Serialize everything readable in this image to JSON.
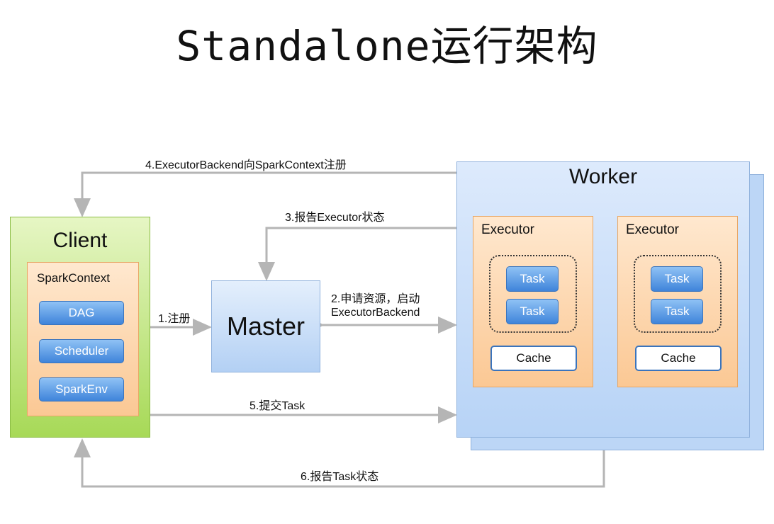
{
  "title": "Standalone运行架构",
  "client": {
    "title": "Client",
    "spark_context": {
      "title": "SparkContext",
      "components": [
        "DAG",
        "Scheduler",
        "SparkEnv"
      ]
    }
  },
  "master": {
    "title": "Master"
  },
  "worker": {
    "title": "Worker",
    "executors": [
      {
        "title": "Executor",
        "tasks": [
          "Task",
          "Task"
        ],
        "cache": "Cache"
      },
      {
        "title": "Executor",
        "tasks": [
          "Task",
          "Task"
        ],
        "cache": "Cache"
      }
    ]
  },
  "steps": {
    "s1": "1.注册",
    "s2_line1": "2.申请资源，启动",
    "s2_line2": "ExecutorBackend",
    "s3": "3.报告Executor状态",
    "s4": "4.ExecutorBackend向SparkContext注册",
    "s5": "5.提交Task",
    "s6": "6.报告Task状态"
  },
  "colors": {
    "arrow": "#b5b5b5",
    "client": "#a7d957",
    "master": "#b3d0f4",
    "worker": "#b7d3f6",
    "executor": "#fbc894",
    "task": "#3f84da"
  }
}
